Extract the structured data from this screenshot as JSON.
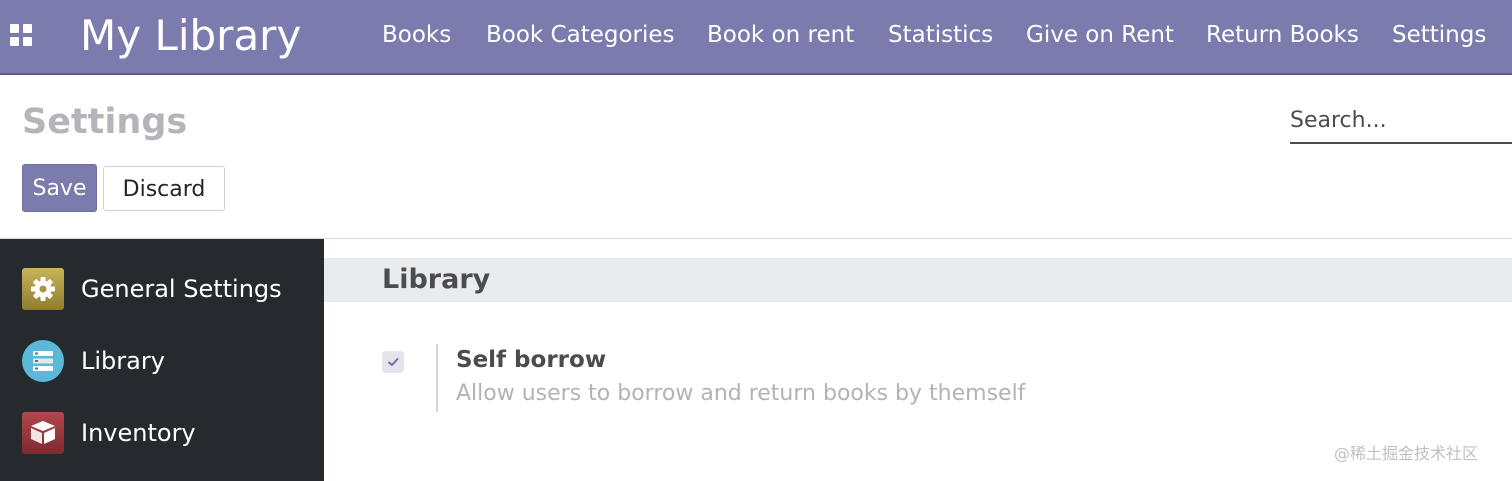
{
  "navbar": {
    "app_title": "My Library",
    "apps_icon": "grid-icon",
    "items": [
      {
        "label": "Books"
      },
      {
        "label": "Book Categories"
      },
      {
        "label": "Book on rent"
      },
      {
        "label": "Statistics"
      },
      {
        "label": "Give on Rent"
      },
      {
        "label": "Return Books"
      },
      {
        "label": "Settings"
      }
    ],
    "color": "#7c7bad"
  },
  "control_panel": {
    "title": "Settings",
    "search_placeholder": "Search...",
    "save_label": "Save",
    "discard_label": "Discard"
  },
  "sidebar": {
    "items": [
      {
        "label": "General Settings",
        "icon": "gear-icon"
      },
      {
        "label": "Library",
        "icon": "books-icon"
      },
      {
        "label": "Inventory",
        "icon": "box-icon"
      }
    ]
  },
  "main": {
    "section_title": "Library",
    "setting": {
      "title": "Self borrow",
      "description": "Allow users to borrow and return books by themself",
      "checked": true
    }
  },
  "watermark": "@稀土掘金技术社区"
}
